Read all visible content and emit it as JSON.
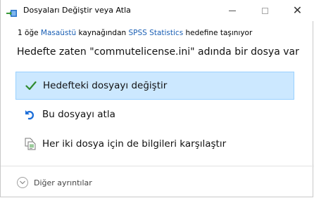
{
  "window": {
    "title": "Dosyaları Değiştir veya Atla",
    "controls": {
      "minimize": "minimize-icon",
      "maximize": "maximize-icon",
      "close": "close-icon"
    }
  },
  "dialog": {
    "subtitle": {
      "prefix": "1 öğe ",
      "source": "Masaüstü",
      "middle": " kaynağından ",
      "destination": "SPSS Statistics",
      "suffix": " hedefine taşınıyor"
    },
    "heading": "Hedefte zaten \"commutelicense.ini\" adında bir dosya var",
    "options": [
      {
        "label": "Hedefteki dosyayı değiştir",
        "icon": "checkmark-icon",
        "selected": true
      },
      {
        "label": "Bu dosyayı atla",
        "icon": "skip-icon",
        "selected": false
      },
      {
        "label": "Her iki dosya için de bilgileri karşılaştır",
        "icon": "compare-files-icon",
        "selected": false
      }
    ],
    "more_details": "Diğer ayrıntılar"
  },
  "colors": {
    "selected_bg": "#cce8ff",
    "selected_border": "#99d1ff",
    "link": "#1a5fb4",
    "check": "#2f8a2f",
    "skip": "#1e6fd9"
  }
}
